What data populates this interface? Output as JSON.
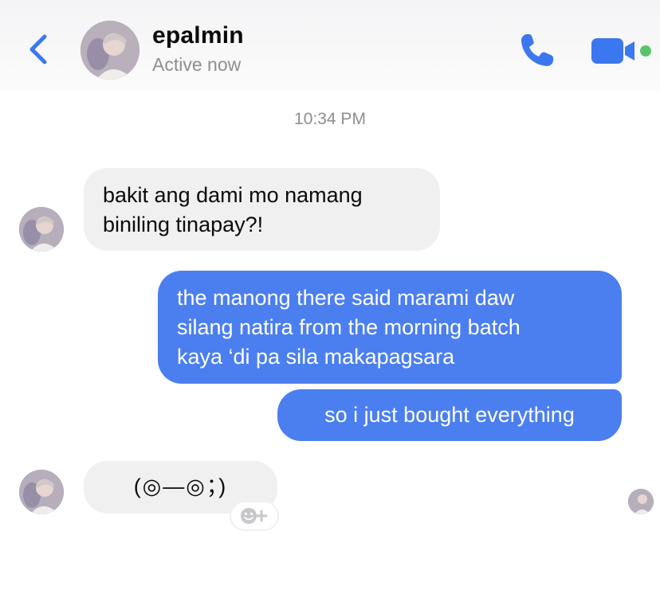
{
  "header": {
    "back_icon": "chevron-left-icon",
    "contact_name": "epalmin",
    "status": "Active now",
    "call_icon": "phone-icon",
    "video_icon": "video-camera-icon",
    "presence_color": "#5ac46a",
    "accent_color": "#3b78f0"
  },
  "conversation": {
    "timestamp": "10:34 PM",
    "messages": [
      {
        "direction": "incoming",
        "lines": [
          "bakit ang dami mo namang",
          "biniling tinapay?!"
        ]
      },
      {
        "direction": "outgoing",
        "lines": [
          "the manong there said marami daw",
          "silang natira from the morning batch",
          "kaya ‘di pa sila makapagsara"
        ]
      },
      {
        "direction": "outgoing",
        "lines": [
          "so i just bought everything"
        ]
      },
      {
        "direction": "incoming",
        "lines": [
          "(◎—◎；)"
        ]
      }
    ],
    "reaction_icon": "add-reaction-icon",
    "seen_icon": "seen-avatar-icon"
  },
  "colors": {
    "incoming_bubble": "#f0f0f0",
    "outgoing_bubble": "#4b7ff0"
  }
}
